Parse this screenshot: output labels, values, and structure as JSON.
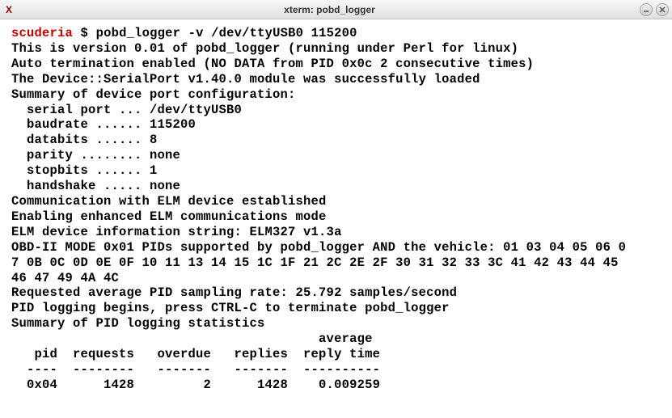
{
  "window": {
    "title": "xterm: pobd_logger"
  },
  "prompt": {
    "host": "scuderia",
    "dollar": "$",
    "command": "pobd_logger -v /dev/ttyUSB0 115200"
  },
  "output": {
    "version_line": "This is version 0.01 of pobd_logger (running under Perl for linux)",
    "auto_term_line": "Auto termination enabled (NO DATA from PID 0x0c 2 consecutive times)",
    "serialport_line": "The Device::SerialPort v1.40.0 module was successfully loaded",
    "config_header": "Summary of device port configuration:",
    "config": {
      "serial_port": "  serial port ... /dev/ttyUSB0",
      "baudrate": "  baudrate ...... 115200",
      "databits": "  databits ...... 8",
      "parity": "  parity ........ none",
      "stopbits": "  stopbits ...... 1",
      "handshake": "  handshake ..... none"
    },
    "comm_established": "Communication with ELM device established",
    "enhanced_mode": "Enabling enhanced ELM communications mode",
    "device_info": "ELM device information string: ELM327 v1.3a",
    "pids_line1": "OBD-II MODE 0x01 PIDs supported by pobd_logger AND the vehicle: 01 03 04 05 06 0",
    "pids_line2": "7 0B 0C 0D 0E 0F 10 11 13 14 15 1C 1F 21 2C 2E 2F 30 31 32 33 3C 41 42 43 44 45",
    "pids_line3": "46 47 49 4A 4C",
    "sampling_rate": "Requested average PID sampling rate: 25.792 samples/second",
    "logging_begins": "PID logging begins, press CTRL-C to terminate pobd_logger",
    "stats_header": "Summary of PID logging statistics",
    "table": {
      "header1": "                                        average",
      "header2": "   pid  requests   overdue   replies  reply time",
      "divider": "  ----  --------   -------   -------  ----------",
      "row1": "  0x04      1428         2      1428    0.009259"
    }
  }
}
